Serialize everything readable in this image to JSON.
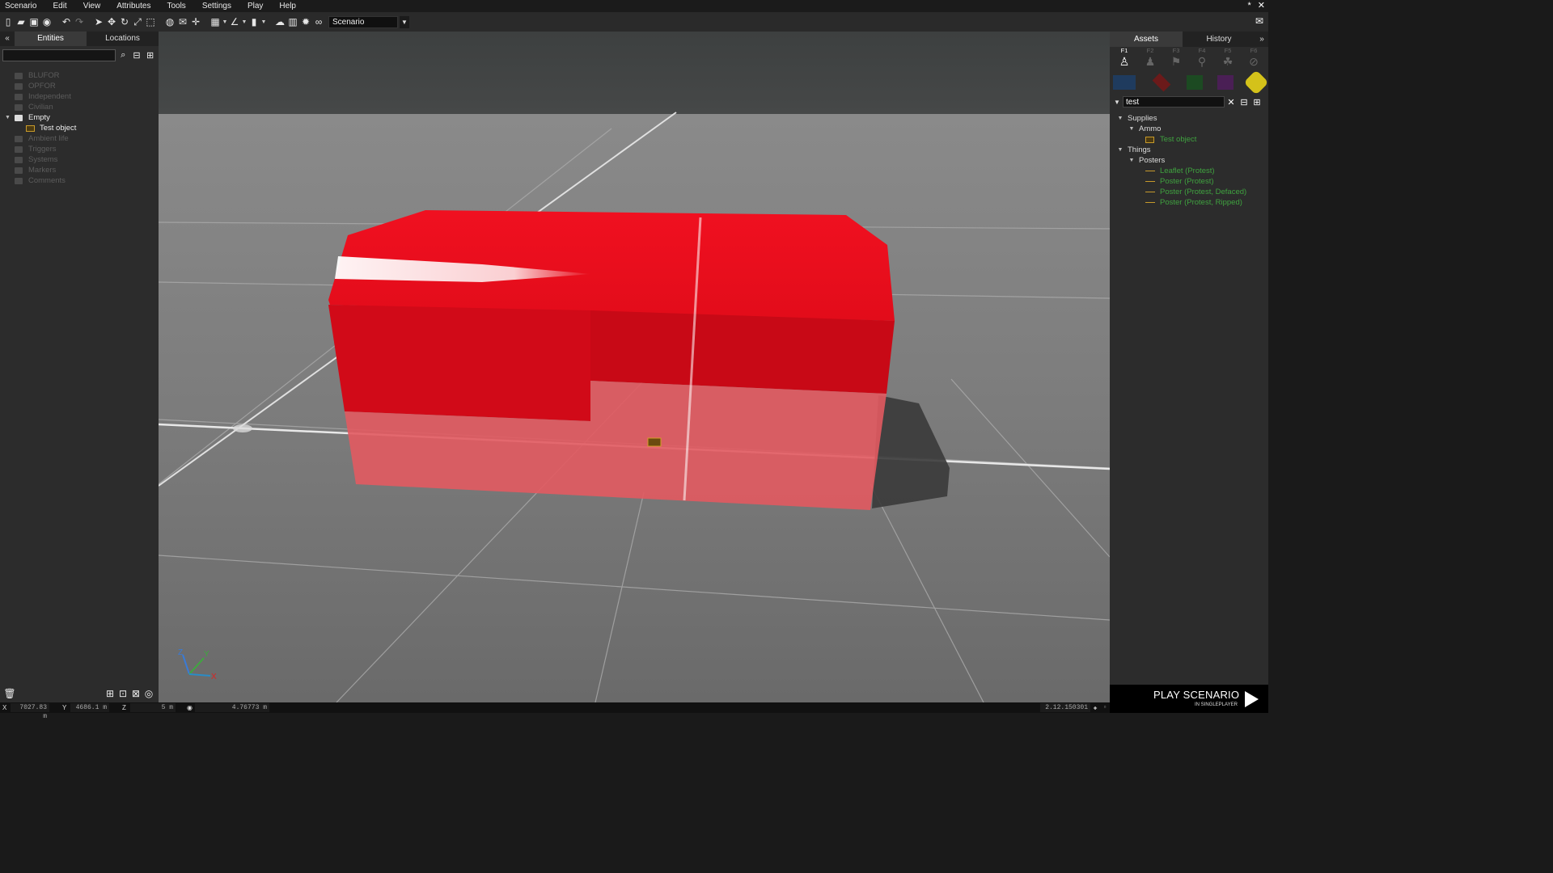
{
  "menu": {
    "items": [
      "Scenario",
      "Edit",
      "View",
      "Attributes",
      "Tools",
      "Settings",
      "Play",
      "Help"
    ],
    "close": "✕",
    "min": "*"
  },
  "toolbar": {
    "scenario_label": "Scenario"
  },
  "left": {
    "tabs": [
      "Entities",
      "Locations"
    ],
    "collapse": "«",
    "search_value": "",
    "tree": [
      {
        "label": "BLUFOR",
        "on": false
      },
      {
        "label": "OPFOR",
        "on": false
      },
      {
        "label": "Independent",
        "on": false
      },
      {
        "label": "Civilian",
        "on": false
      },
      {
        "label": "Empty",
        "on": true
      },
      {
        "label": "Test object",
        "child": true
      },
      {
        "label": "Ambient life",
        "on": false
      },
      {
        "label": "Triggers",
        "on": false
      },
      {
        "label": "Systems",
        "on": false
      },
      {
        "label": "Markers",
        "on": false
      },
      {
        "label": "Comments",
        "on": false
      }
    ]
  },
  "right": {
    "tabs": [
      "Assets",
      "History"
    ],
    "expand": "»",
    "fkeys": [
      "F1",
      "F2",
      "F3",
      "F4",
      "F5",
      "F6"
    ],
    "fkey_icons": [
      "person-icon",
      "group-icon",
      "module-icon",
      "marker-icon",
      "composition-icon",
      "no-icon"
    ],
    "sides_colors": [
      "#1f3b5e",
      "#6b1a1a",
      "#1c4a22",
      "#4a1f55",
      "#d4c21a"
    ],
    "search_value": "test",
    "tree": [
      {
        "level": 0,
        "label": "Supplies",
        "exp": "▼"
      },
      {
        "level": 1,
        "label": "Ammo",
        "exp": "▼"
      },
      {
        "level": 2,
        "label": "Test object",
        "kind": "obj"
      },
      {
        "level": 0,
        "label": "Things",
        "exp": "▼"
      },
      {
        "level": 1,
        "label": "Posters",
        "exp": "▼"
      },
      {
        "level": 2,
        "label": "Leaflet (Protest)",
        "kind": "line"
      },
      {
        "level": 2,
        "label": "Poster (Protest)",
        "kind": "line"
      },
      {
        "level": 2,
        "label": "Poster (Protest, Defaced)",
        "kind": "line"
      },
      {
        "level": 2,
        "label": "Poster (Protest, Ripped)",
        "kind": "line"
      }
    ]
  },
  "play": {
    "title": "PLAY SCENARIO",
    "subtitle": "IN SINGLEPLAYER"
  },
  "status": {
    "x_label": "X",
    "x_value": "7027.83 m",
    "y_label": "Y",
    "y_value": "4686.1 m",
    "z_label": "Z",
    "z_value": "5 m",
    "cam_value": "4.76773 m",
    "version": "2.12.150301"
  },
  "axis": {
    "z": "Z",
    "y": "Y",
    "x": "X"
  },
  "colors": {
    "object_red": "#e8101e",
    "bg_dark": "#2c2c2c"
  }
}
